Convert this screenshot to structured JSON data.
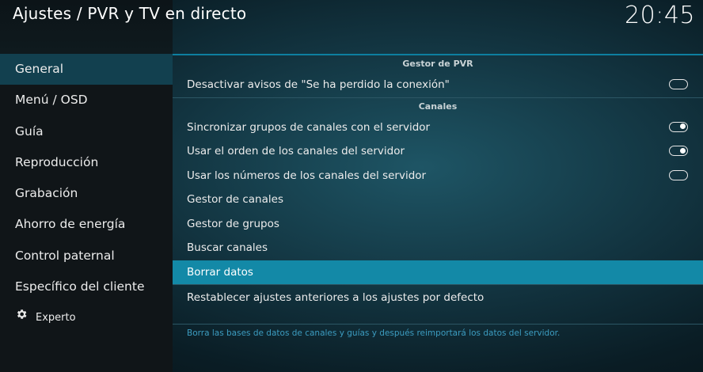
{
  "header": {
    "title": "Ajustes / PVR y TV en directo",
    "clock": "20:45"
  },
  "sidebar": {
    "items": [
      {
        "label": "General"
      },
      {
        "label": "Menú / OSD"
      },
      {
        "label": "Guía"
      },
      {
        "label": "Reproducción"
      },
      {
        "label": "Grabación"
      },
      {
        "label": "Ahorro de energía"
      },
      {
        "label": "Control paternal"
      },
      {
        "label": "Específico del cliente"
      },
      {
        "label": "Experto",
        "icon": "gear-icon"
      }
    ],
    "active_index": 0
  },
  "main": {
    "sections": [
      {
        "header": "Gestor de PVR",
        "rows": [
          {
            "label": "Desactivar avisos de \"Se ha perdido la conexión\"",
            "toggle": "off"
          }
        ]
      },
      {
        "header": "Canales",
        "rows": [
          {
            "label": "Sincronizar grupos de canales con el servidor",
            "toggle": "on"
          },
          {
            "label": "Usar el orden de los canales del servidor",
            "toggle": "on"
          },
          {
            "label": "Usar los números de los canales del servidor",
            "toggle": "off"
          },
          {
            "label": "Gestor de canales"
          },
          {
            "label": "Gestor de grupos"
          },
          {
            "label": "Buscar canales"
          },
          {
            "label": "Borrar datos",
            "selected": true
          },
          {
            "label": "Restablecer ajustes anteriores a los ajustes por defecto"
          }
        ]
      }
    ],
    "description": "Borra las bases de datos de canales y guías y después reimportará los datos del servidor."
  },
  "colors": {
    "accent": "#1389a7",
    "description_text": "#3c9cc0",
    "sidebar_active": "#12404f"
  }
}
